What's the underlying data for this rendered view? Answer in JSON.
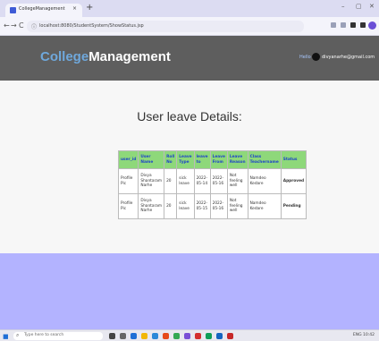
{
  "browser": {
    "tab_title": "CollegeManagement",
    "tab_close": "×",
    "new_tab": "+",
    "url": "localhost:8080/StudentSystem/ShowStatus.jsp",
    "win_min": "–",
    "win_max": "▢",
    "win_close": "✕",
    "back": "←",
    "forward": "→",
    "reload": "C"
  },
  "header": {
    "brand_accent": "College",
    "brand_rest": "Management",
    "hello": "Hello",
    "user_email": "divyanarhe@gmail.com"
  },
  "page": {
    "title": "User leave Details:"
  },
  "table": {
    "columns": [
      "user_id",
      "User Name",
      "Roll No",
      "Leave Type",
      "leave to",
      "Leave From",
      "Leave Reason",
      "Class Teachername",
      "Status"
    ],
    "rows": [
      {
        "user_id": "Profile Pic",
        "user_name": "Divya Shantaram Narhe",
        "roll_no": "20",
        "leave_type": "sick leave",
        "leave_to": "2022-05-14",
        "leave_from": "2022-05-16",
        "leave_reason": "Not feeling well",
        "class_teacher": "Namdeo Kedare",
        "status": "Approved"
      },
      {
        "user_id": "Profile Pic",
        "user_name": "Divya Shantaram Narhe",
        "roll_no": "20",
        "leave_type": "sick leave",
        "leave_to": "2022-05-15",
        "leave_from": "2022-05-16",
        "leave_reason": "Not feeling well",
        "class_teacher": "Namdeo Kedare",
        "status": "Pending"
      }
    ]
  },
  "taskbar": {
    "search_placeholder": "Type here to search",
    "tray_text": "ENG 10:42"
  },
  "colors": {
    "header_bg": "#5e5e5e",
    "brand_accent": "#6fa8dc",
    "table_header_bg": "#8ed87a",
    "footer_bg": "#b3b3ff",
    "status_link": "#1e44c8"
  }
}
